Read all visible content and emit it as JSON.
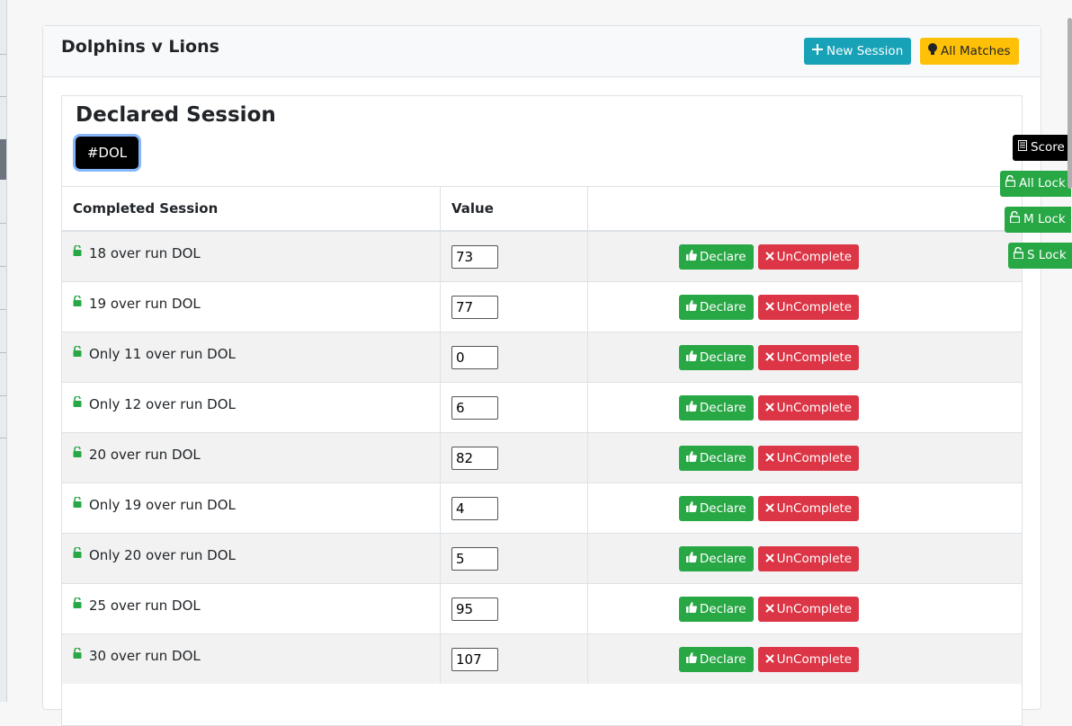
{
  "header": {
    "title": "Dolphins v Lions",
    "new_session_label": "New Session",
    "all_matches_label": "All Matches"
  },
  "panel": {
    "title": "Declared Session",
    "tag_label": "#DOL"
  },
  "table": {
    "columns": [
      "Completed Session",
      "Value",
      ""
    ],
    "declare_label": "Declare",
    "uncomplete_label": "UnComplete",
    "rows": [
      {
        "name": "18 over run DOL",
        "value": "73"
      },
      {
        "name": "19 over run DOL",
        "value": "77"
      },
      {
        "name": "Only 11 over run DOL",
        "value": "0"
      },
      {
        "name": "Only 12 over run DOL",
        "value": "6"
      },
      {
        "name": "20 over run DOL",
        "value": "82"
      },
      {
        "name": "Only 19 over run DOL",
        "value": "4"
      },
      {
        "name": "Only 20 over run DOL",
        "value": "5"
      },
      {
        "name": "25 over run DOL",
        "value": "95"
      },
      {
        "name": "30 over run DOL",
        "value": "107"
      }
    ]
  },
  "side_buttons": {
    "score": "Score",
    "all_lock": "All Lock",
    "m_lock": "M Lock",
    "s_lock": "S Lock"
  },
  "colors": {
    "info": "#17a2b8",
    "warning": "#ffc107",
    "success": "#28a745",
    "danger": "#dc3545"
  }
}
